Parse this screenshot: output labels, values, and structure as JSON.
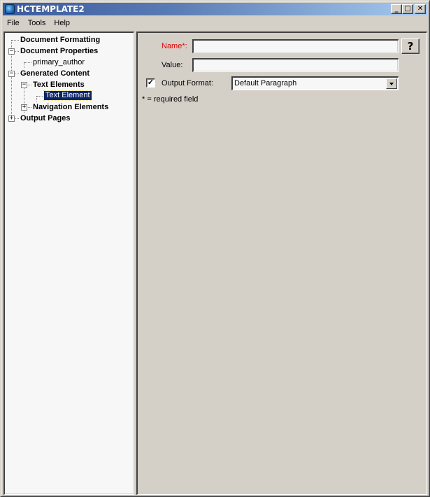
{
  "window": {
    "title": "HCTEMPLATE2",
    "icon": "app-globe-icon",
    "controls": {
      "minimize": "_",
      "maximize": "□",
      "close": "✕"
    }
  },
  "menubar": {
    "items": [
      {
        "label": "File"
      },
      {
        "label": "Tools"
      },
      {
        "label": "Help"
      }
    ]
  },
  "tree": {
    "nodes": [
      {
        "label": "Document Formatting",
        "level": 0,
        "bold": true,
        "expander": null
      },
      {
        "label": "Document Properties",
        "level": 0,
        "bold": true,
        "expander": "−"
      },
      {
        "label": "primary_author",
        "level": 1,
        "bold": false,
        "expander": null
      },
      {
        "label": "Generated Content",
        "level": 0,
        "bold": true,
        "expander": "−"
      },
      {
        "label": "Text Elements",
        "level": 1,
        "bold": true,
        "expander": "−"
      },
      {
        "label": "Text Element",
        "level": 2,
        "bold": false,
        "expander": null,
        "selected": true
      },
      {
        "label": "Navigation Elements",
        "level": 1,
        "bold": true,
        "expander": "+"
      },
      {
        "label": "Output Pages",
        "level": 0,
        "bold": true,
        "expander": "+"
      }
    ]
  },
  "form": {
    "name_label": "Name*:",
    "name_value": "",
    "value_label": "Value:",
    "value_value": "",
    "help_button": "?",
    "output_format_checked": true,
    "checkbox_mark": "✓",
    "output_format_label": "Output Format:",
    "output_format_selected": "Default Paragraph",
    "required_note": "* = required field"
  },
  "colors": {
    "required_label": "#e00000",
    "selection_bg": "#0a246a",
    "title_gradient_start": "#3a5a9c",
    "title_gradient_end": "#a6caf0"
  }
}
